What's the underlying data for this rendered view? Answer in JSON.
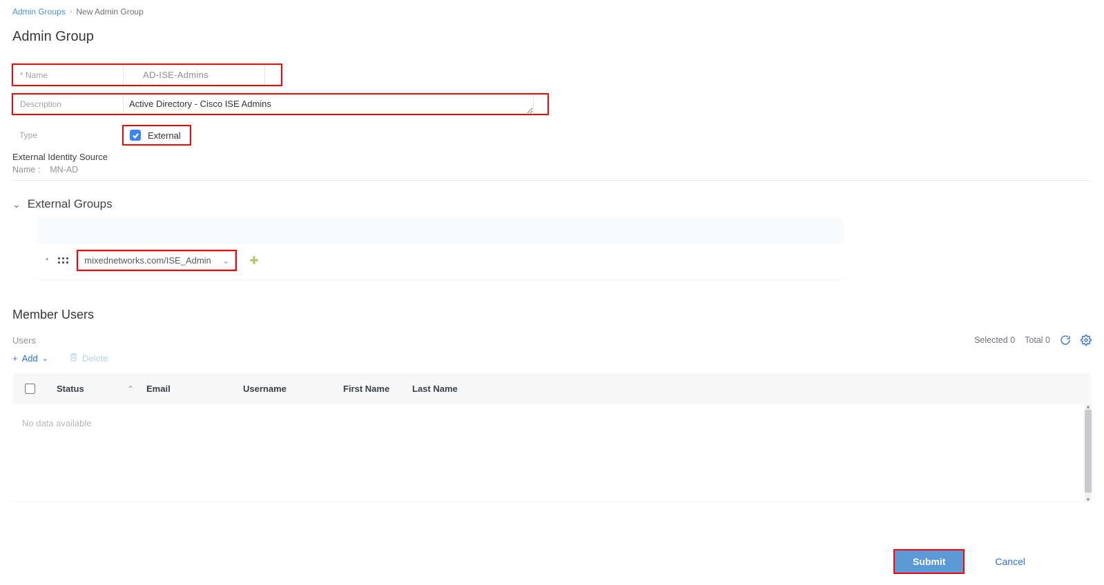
{
  "breadcrumb": {
    "root": "Admin Groups",
    "current": "New Admin Group"
  },
  "page_title": "Admin Group",
  "fields": {
    "name_label": "* Name",
    "name_value": "AD-ISE-Admins",
    "desc_label": "Description",
    "desc_value": "Active Directory - Cisco ISE Admins",
    "type_label": "Type",
    "type_value": "External",
    "type_checked": true
  },
  "external_identity": {
    "heading": "External Identity Source",
    "name_label": "Name :",
    "name_value": "MN-AD"
  },
  "external_groups": {
    "heading": "External Groups",
    "selected": "mixednetworks.com/ISE_Admin"
  },
  "member_users": {
    "heading": "Member Users",
    "table_label": "Users",
    "selected_label": "Selected",
    "selected_count": "0",
    "total_label": "Total",
    "total_count": "0",
    "add_label": "Add",
    "delete_label": "Delete",
    "columns": {
      "status": "Status",
      "email": "Email",
      "username": "Username",
      "first_name": "First Name",
      "last_name": "Last Name"
    },
    "empty_text": "No data available"
  },
  "footer": {
    "submit": "Submit",
    "cancel": "Cancel"
  }
}
